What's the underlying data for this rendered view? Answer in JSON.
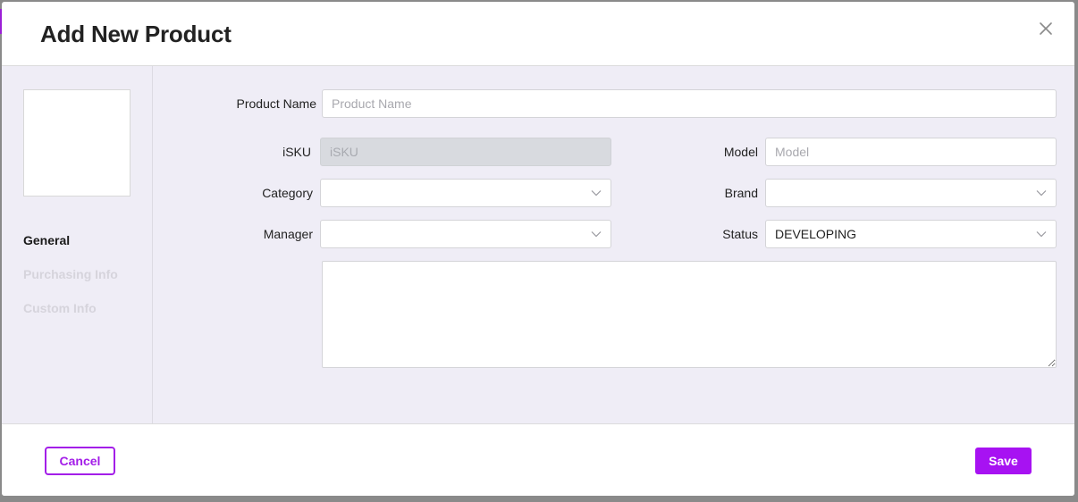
{
  "modal": {
    "title": "Add New Product"
  },
  "side_nav": {
    "items": [
      {
        "label": "General",
        "active": true
      },
      {
        "label": "Purchasing Info",
        "active": false
      },
      {
        "label": "Custom Info",
        "active": false
      }
    ]
  },
  "form": {
    "product_name": {
      "label": "Product Name",
      "placeholder": "Product Name",
      "value": ""
    },
    "isku": {
      "label": "iSKU",
      "placeholder": "iSKU",
      "value": "",
      "disabled": true
    },
    "model": {
      "label": "Model",
      "placeholder": "Model",
      "value": ""
    },
    "category": {
      "label": "Category",
      "value": ""
    },
    "brand": {
      "label": "Brand",
      "value": ""
    },
    "manager": {
      "label": "Manager",
      "value": ""
    },
    "status": {
      "label": "Status",
      "value": "DEVELOPING"
    },
    "notes": {
      "value": ""
    }
  },
  "footer": {
    "cancel_label": "Cancel",
    "save_label": "Save"
  },
  "colors": {
    "accent": "#a712f2",
    "body_background": "#efedf6"
  },
  "icons": {
    "close": "close-icon",
    "dropdown": "chevron-down-icon"
  }
}
